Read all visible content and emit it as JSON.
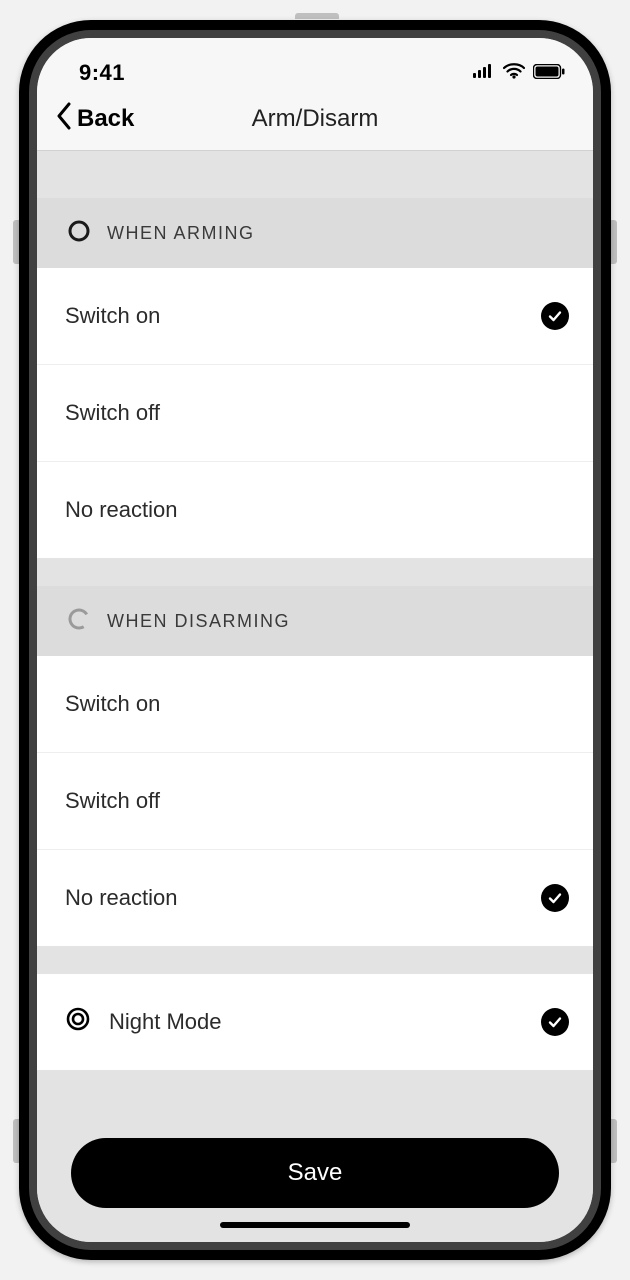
{
  "statusbar": {
    "time": "9:41"
  },
  "nav": {
    "back": "Back",
    "title": "Arm/Disarm"
  },
  "sections": {
    "arming": {
      "header": "WHEN ARMING",
      "options": [
        {
          "label": "Switch on",
          "selected": true
        },
        {
          "label": "Switch off",
          "selected": false
        },
        {
          "label": "No reaction",
          "selected": false
        }
      ]
    },
    "disarming": {
      "header": "WHEN DISARMING",
      "options": [
        {
          "label": "Switch on",
          "selected": false
        },
        {
          "label": "Switch off",
          "selected": false
        },
        {
          "label": "No reaction",
          "selected": true
        }
      ]
    },
    "night": {
      "label": "Night Mode",
      "selected": true
    }
  },
  "footer": {
    "save": "Save"
  }
}
